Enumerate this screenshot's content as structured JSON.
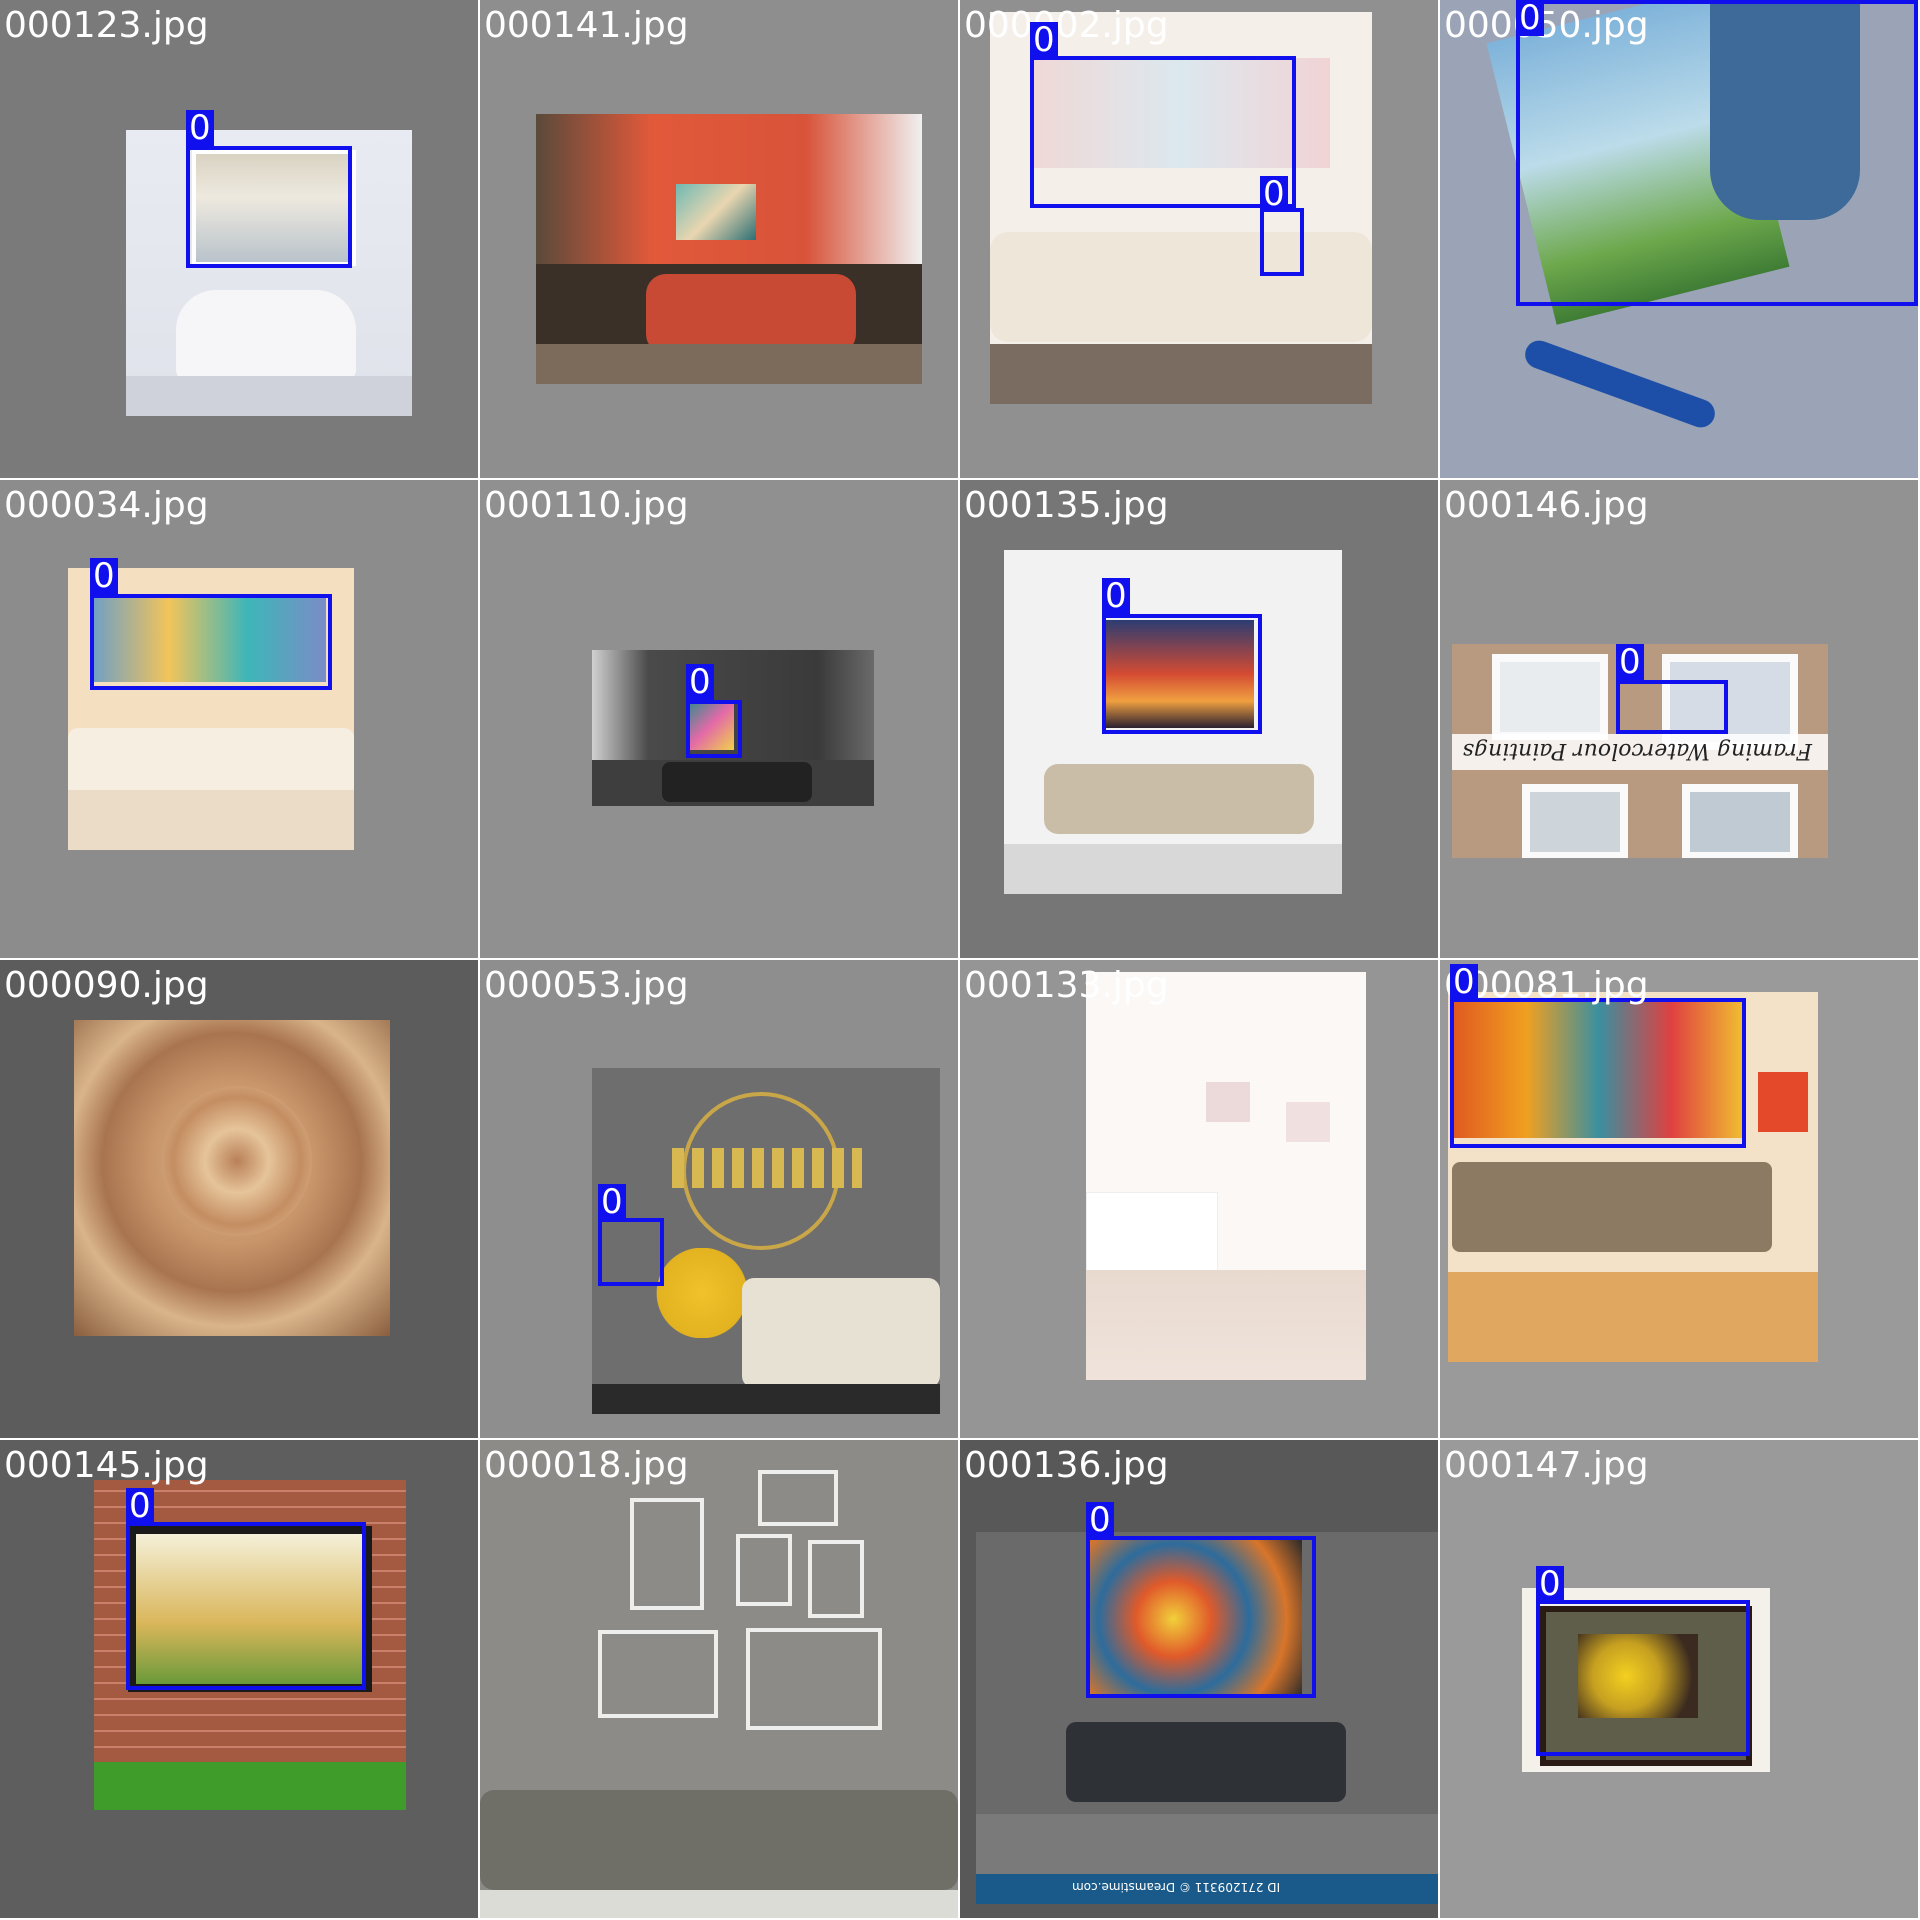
{
  "label_class": "0",
  "colors": {
    "box": "#1010ee",
    "label_text": "#ffffff",
    "filename_text": "#ffffff"
  },
  "tiles": [
    {
      "filename": "000123.jpg",
      "boxes": [
        {
          "label": "0"
        }
      ]
    },
    {
      "filename": "000141.jpg",
      "boxes": []
    },
    {
      "filename": "000002.jpg",
      "boxes": [
        {
          "label": "0"
        },
        {
          "label": "0"
        }
      ]
    },
    {
      "filename": "000050.jpg",
      "boxes": [
        {
          "label": "0"
        }
      ]
    },
    {
      "filename": "000034.jpg",
      "boxes": [
        {
          "label": "0"
        }
      ]
    },
    {
      "filename": "000110.jpg",
      "boxes": [
        {
          "label": "0"
        }
      ]
    },
    {
      "filename": "000135.jpg",
      "boxes": [
        {
          "label": "0"
        }
      ]
    },
    {
      "filename": "000146.jpg",
      "boxes": [
        {
          "label": "0"
        }
      ],
      "caption": "Framing Watercolour Paintings"
    },
    {
      "filename": "000090.jpg",
      "boxes": []
    },
    {
      "filename": "000053.jpg",
      "boxes": [
        {
          "label": "0"
        }
      ]
    },
    {
      "filename": "000133.jpg",
      "boxes": []
    },
    {
      "filename": "000081.jpg",
      "boxes": [
        {
          "label": "0"
        }
      ]
    },
    {
      "filename": "000145.jpg",
      "boxes": [
        {
          "label": "0"
        }
      ]
    },
    {
      "filename": "000018.jpg",
      "boxes": []
    },
    {
      "filename": "000136.jpg",
      "boxes": [
        {
          "label": "0"
        }
      ],
      "watermark": "ID 271209311 © Dreamstime.com"
    },
    {
      "filename": "000147.jpg",
      "boxes": [
        {
          "label": "0"
        }
      ]
    }
  ]
}
